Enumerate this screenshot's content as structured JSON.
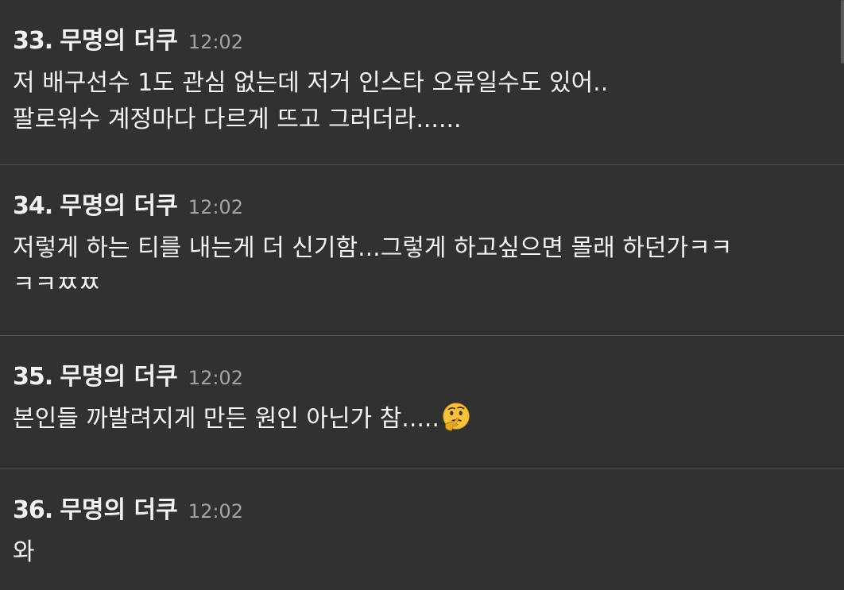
{
  "comments": [
    {
      "number": "33.",
      "nickname": "무명의 더쿠",
      "time": "12:02",
      "lines": [
        "저 배구선수 1도 관심 없는데 저거 인스타 오류일수도 있어..",
        "팔로워수 계정마다 다르게 뜨고 그러더라......"
      ]
    },
    {
      "number": "34.",
      "nickname": "무명의 더쿠",
      "time": "12:02",
      "lines": [
        "저렇게 하는 티를 내는게 더 신기함...그렇게 하고싶으면 몰래 하던가ㅋㅋ",
        "ㅋㅋㅉㅉ"
      ]
    },
    {
      "number": "35.",
      "nickname": "무명의 더쿠",
      "time": "12:02",
      "lines": [
        "본인들 까발려지게 만든 원인 아닌가 참....."
      ],
      "emoji": "thinking-face-icon"
    },
    {
      "number": "36.",
      "nickname": "무명의 더쿠",
      "time": "12:02",
      "lines": [
        "와"
      ]
    }
  ],
  "colors": {
    "background": "#313131",
    "divider": "#4e4e4e",
    "time": "#a4a4a4",
    "text": "#f4f4f4"
  }
}
